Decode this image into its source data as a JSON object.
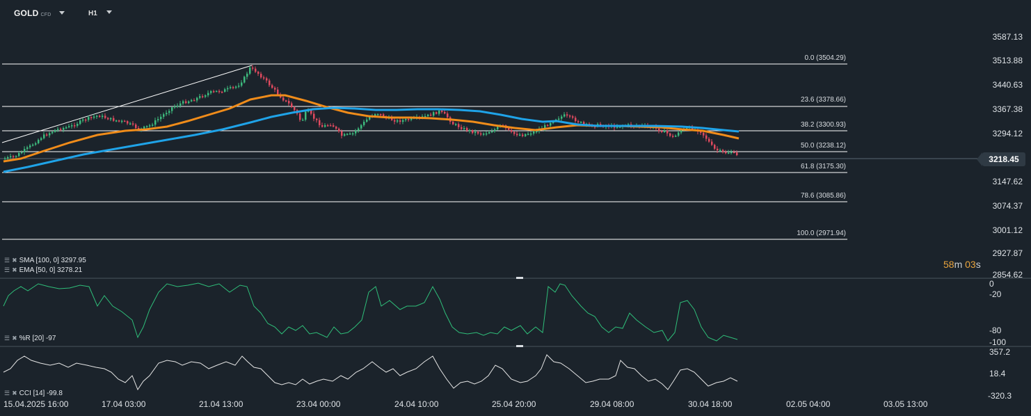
{
  "header": {
    "symbol": "GOLD",
    "symbol_tag": "CFD",
    "timeframe": "H1"
  },
  "price_axis": [
    "3587.13",
    "3513.88",
    "3440.63",
    "3367.38",
    "3294.12",
    "3147.62",
    "3074.37",
    "3001.12",
    "2927.87",
    "2854.62"
  ],
  "current_price": "3218.45",
  "timer": {
    "minutes": "58",
    "m": "m",
    "seconds": "03",
    "s": "s"
  },
  "fib_levels": [
    {
      "label": "0.0 (3504.29)"
    },
    {
      "label": "23.6 (3378.66)"
    },
    {
      "label": "38.2 (3300.93)"
    },
    {
      "label": "50.0 (3238.12)"
    },
    {
      "label": "61.8 (3175.30)"
    },
    {
      "label": "78.6 (3085.86)"
    },
    {
      "label": "100.0 (2971.94)"
    }
  ],
  "legends": {
    "sma": "SMA [100, 0] 3297.95",
    "ema": "EMA [50, 0] 3278.21",
    "wr": "%R [20] -97",
    "cci": "CCI [14] -99.8"
  },
  "wr_axis": [
    "0",
    "-20",
    "-80",
    "-100"
  ],
  "cci_axis": [
    "357.2",
    "18.4",
    "-320.3"
  ],
  "time_axis": [
    "15.04.2025 16:00",
    "17.04 03:00",
    "21.04 13:00",
    "23.04 00:00",
    "24.04 10:00",
    "25.04 20:00",
    "29.04 08:00",
    "30.04 18:00",
    "02.05 04:00",
    "03.05 13:00"
  ],
  "colors": {
    "background": "#1b232b",
    "up_candle": "#3dbb7e",
    "down_candle": "#e04a5f",
    "sma": "#1fa3e8",
    "ema": "#f08c1a",
    "wr_line": "#2fbf7a",
    "cci_line": "#e6e6e6"
  }
}
